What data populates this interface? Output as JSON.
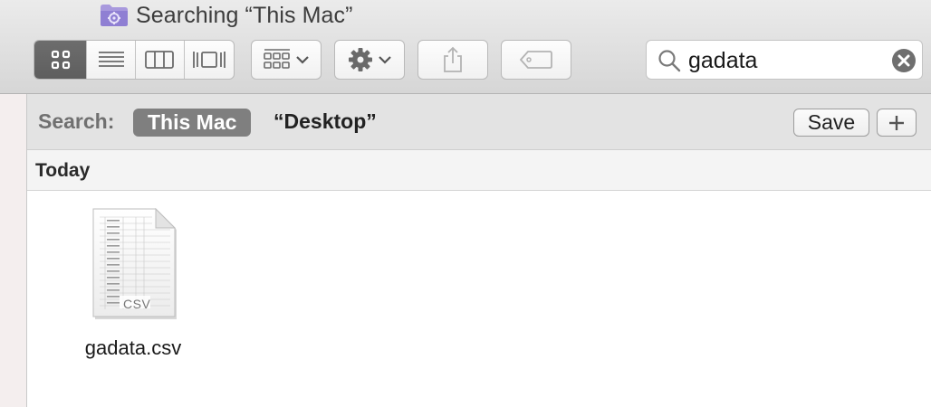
{
  "window": {
    "title": "Searching “This Mac”"
  },
  "toolbar": {
    "view_modes": [
      {
        "name": "icon-view",
        "icon": "grid-icon",
        "active": true
      },
      {
        "name": "list-view",
        "icon": "list-icon",
        "active": false
      },
      {
        "name": "column-view",
        "icon": "columns-icon",
        "active": false
      },
      {
        "name": "cover-flow-view",
        "icon": "cover-flow-icon",
        "active": false
      }
    ],
    "buttons": [
      "arrange-icon",
      "gear-icon",
      "share-icon",
      "tag-icon"
    ]
  },
  "search": {
    "value": "gadata",
    "icon": "search-icon",
    "clear_icon": "clear-icon"
  },
  "scope_bar": {
    "label": "Search:",
    "this_mac": "This Mac",
    "desktop": "“Desktop”",
    "save_label": "Save",
    "add_label": "+"
  },
  "section": {
    "header": "Today"
  },
  "files": [
    {
      "name": "gadata.csv",
      "type_label": "CSV",
      "icon": "csv-document-icon"
    }
  ],
  "colors": {
    "toolbar_bg": "#e0e0e0",
    "active_segment": "#666666",
    "scope_selected": "#7f7f7f",
    "folder_purple": "#9e8fd8"
  }
}
